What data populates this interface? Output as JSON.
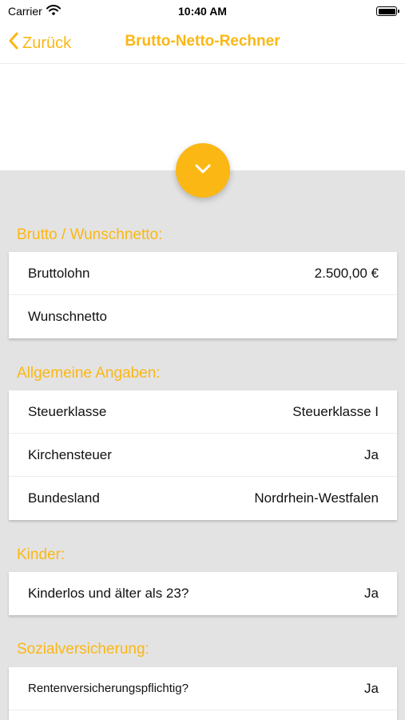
{
  "status": {
    "carrier": "Carrier",
    "time": "10:40 AM"
  },
  "nav": {
    "back_label": "Zurück",
    "title": "Brutto-Netto-Rechner"
  },
  "colors": {
    "accent": "#fbb714",
    "background": "#e3e3e3"
  },
  "sections": {
    "brutto": {
      "title": "Brutto / Wunschnetto:",
      "rows": [
        {
          "label": "Bruttolohn",
          "value": "2.500,00 €"
        },
        {
          "label": "Wunschnetto",
          "value": ""
        }
      ]
    },
    "allgemein": {
      "title": "Allgemeine Angaben:",
      "rows": [
        {
          "label": "Steuerklasse",
          "value": "Steuerklasse I"
        },
        {
          "label": "Kirchensteuer",
          "value": "Ja"
        },
        {
          "label": "Bundesland",
          "value": "Nordrhein-Westfalen"
        }
      ]
    },
    "kinder": {
      "title": "Kinder:",
      "rows": [
        {
          "label": "Kinderlos und älter als 23?",
          "value": "Ja"
        }
      ]
    },
    "sozial": {
      "title": "Sozialversicherung:",
      "rows": [
        {
          "label": "Rentenversicherungspflichtig?",
          "value": "Ja"
        }
      ]
    }
  },
  "icons": {
    "back": "chevron-left-icon",
    "expand": "chevron-down-icon",
    "wifi": "wifi-icon",
    "battery": "battery-icon"
  }
}
